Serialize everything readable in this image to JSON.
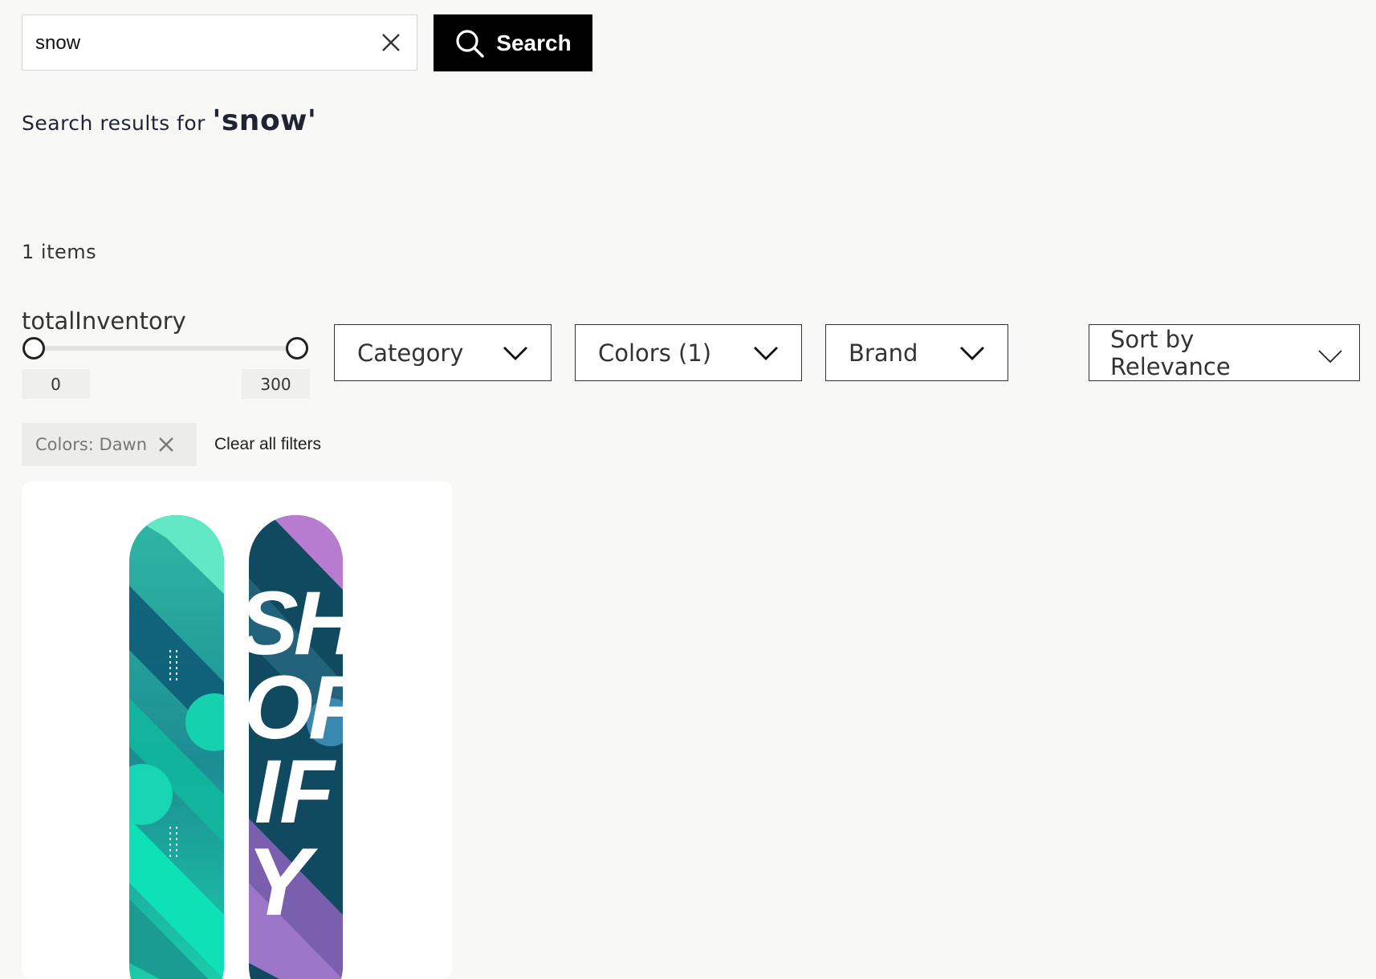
{
  "search": {
    "value": "snow",
    "button_label": "Search"
  },
  "results": {
    "prefix": "Search results for ",
    "query": "'snow'",
    "count_text": "1 items"
  },
  "filters": {
    "slider": {
      "label": "totalInventory",
      "min": "0",
      "max": "300"
    },
    "dropdowns": {
      "category": "Category",
      "colors": "Colors (1)",
      "brand": "Brand",
      "sort": "Sort by Relevance"
    },
    "active_chip": "Colors: Dawn",
    "clear_all": "Clear all filters"
  },
  "product": {
    "image_icon": "snowboard-image",
    "board_text": "SHOPIFY"
  },
  "colors": {
    "button_bg": "#000000",
    "board_teal": "#1fd8b0",
    "board_purple": "#a47bd1",
    "board_navy": "#0f4a60"
  }
}
